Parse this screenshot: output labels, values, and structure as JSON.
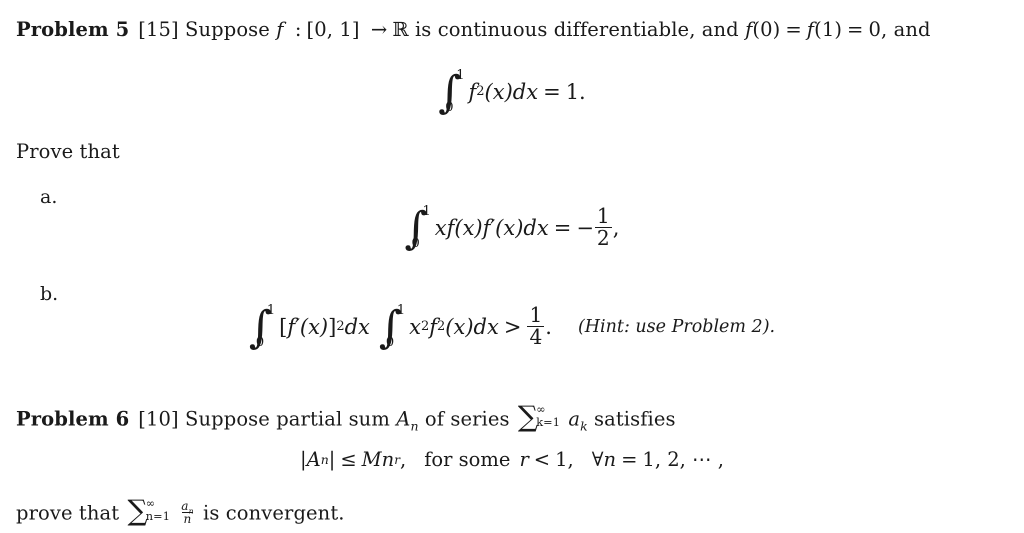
{
  "document": {
    "type": "math-problem-set",
    "problems": [
      {
        "id": "problem-5",
        "heading": "Problem 5",
        "points": "[15]",
        "statement_lead": "Suppose",
        "statement": "Suppose f : [0, 1] → ℝ is continuous differentiable, and f(0) = f(1) = 0, and",
        "intro_parts": {
          "suppose": "Suppose",
          "f": "f",
          "colon": ":",
          "domain": "[0, 1]",
          "arrow": "→",
          "codomain": "ℝ",
          "is_text": "is continuous differentiable, and",
          "f0": "f",
          "zero_arg": "(0)",
          "eq1": "=",
          "f1": "f",
          "one_arg": "(1)",
          "eq2": "=",
          "zero": "0,",
          "and": "and"
        },
        "display_equation": {
          "id": "eq-p5-hypothesis",
          "integral_lower": "0",
          "integral_upper": "1",
          "integrand_fn": "f",
          "integrand_exp": "2",
          "integrand_arg": "(x)",
          "differential": "dx",
          "relation": "=",
          "rhs": "1."
        },
        "prove_label": "Prove that",
        "items": [
          {
            "label": "a.",
            "id": "item-a",
            "equation": {
              "integral_lower": "0",
              "integral_upper": "1",
              "integrand_prefix": "x",
              "integrand_f": "f",
              "integrand_f_arg": "(x)",
              "integrand_fprime": "f′",
              "integrand_fprime_arg": "(x)",
              "differential": "dx",
              "relation": "=",
              "rhs_sign": "−",
              "rhs_num": "1",
              "rhs_den": "2",
              "trailing": ","
            }
          },
          {
            "label": "b.",
            "id": "item-b",
            "equation": {
              "int1_lower": "0",
              "int1_upper": "1",
              "int1_body_open": "[",
              "int1_fprime": "f′",
              "int1_arg": "(x)",
              "int1_body_close": "]",
              "int1_exp": "2",
              "int1_differential": "dx",
              "int2_lower": "0",
              "int2_upper": "1",
              "int2_x": "x",
              "int2_x_exp": "2",
              "int2_f": "f",
              "int2_f_exp": "2",
              "int2_arg": "(x)",
              "int2_differential": "dx",
              "relation": ">",
              "rhs_num": "1",
              "rhs_den": "4",
              "period": ".",
              "hint": "(Hint: use Problem 2)."
            }
          }
        ]
      },
      {
        "id": "problem-6",
        "heading": "Problem 6",
        "points": "[10]",
        "intro_parts": {
          "suppose": "Suppose partial sum",
          "A": "A",
          "A_sub": "n",
          "of_series": "of series",
          "sum_symbol": "∑",
          "sum_upper": "∞",
          "sum_lower": "k=1",
          "term": "a",
          "term_sub": "k",
          "satisfies": "satisfies"
        },
        "display_equation": {
          "id": "eq-p6-condition",
          "abs_open": "|",
          "A": "A",
          "A_sub": "n",
          "abs_close": "|",
          "relation": "≤",
          "M": "M",
          "n": "n",
          "n_exp": "r",
          "comma1": ",",
          "for_some": "for some",
          "r": "r",
          "lt": "<",
          "one": "1,",
          "forall": "∀",
          "forall_var": "n",
          "eq": "=",
          "values": "1, 2, ⋯ ,"
        },
        "conclusion": {
          "lead": "prove that",
          "sum_symbol": "∑",
          "sum_upper": "∞",
          "sum_lower": "n=1",
          "frac_num": "a",
          "frac_num_sub": "n",
          "frac_den": "n",
          "tail": "is convergent."
        }
      }
    ]
  },
  "style": {
    "text_color": "#1a1a1a",
    "background_color": "#ffffff"
  }
}
